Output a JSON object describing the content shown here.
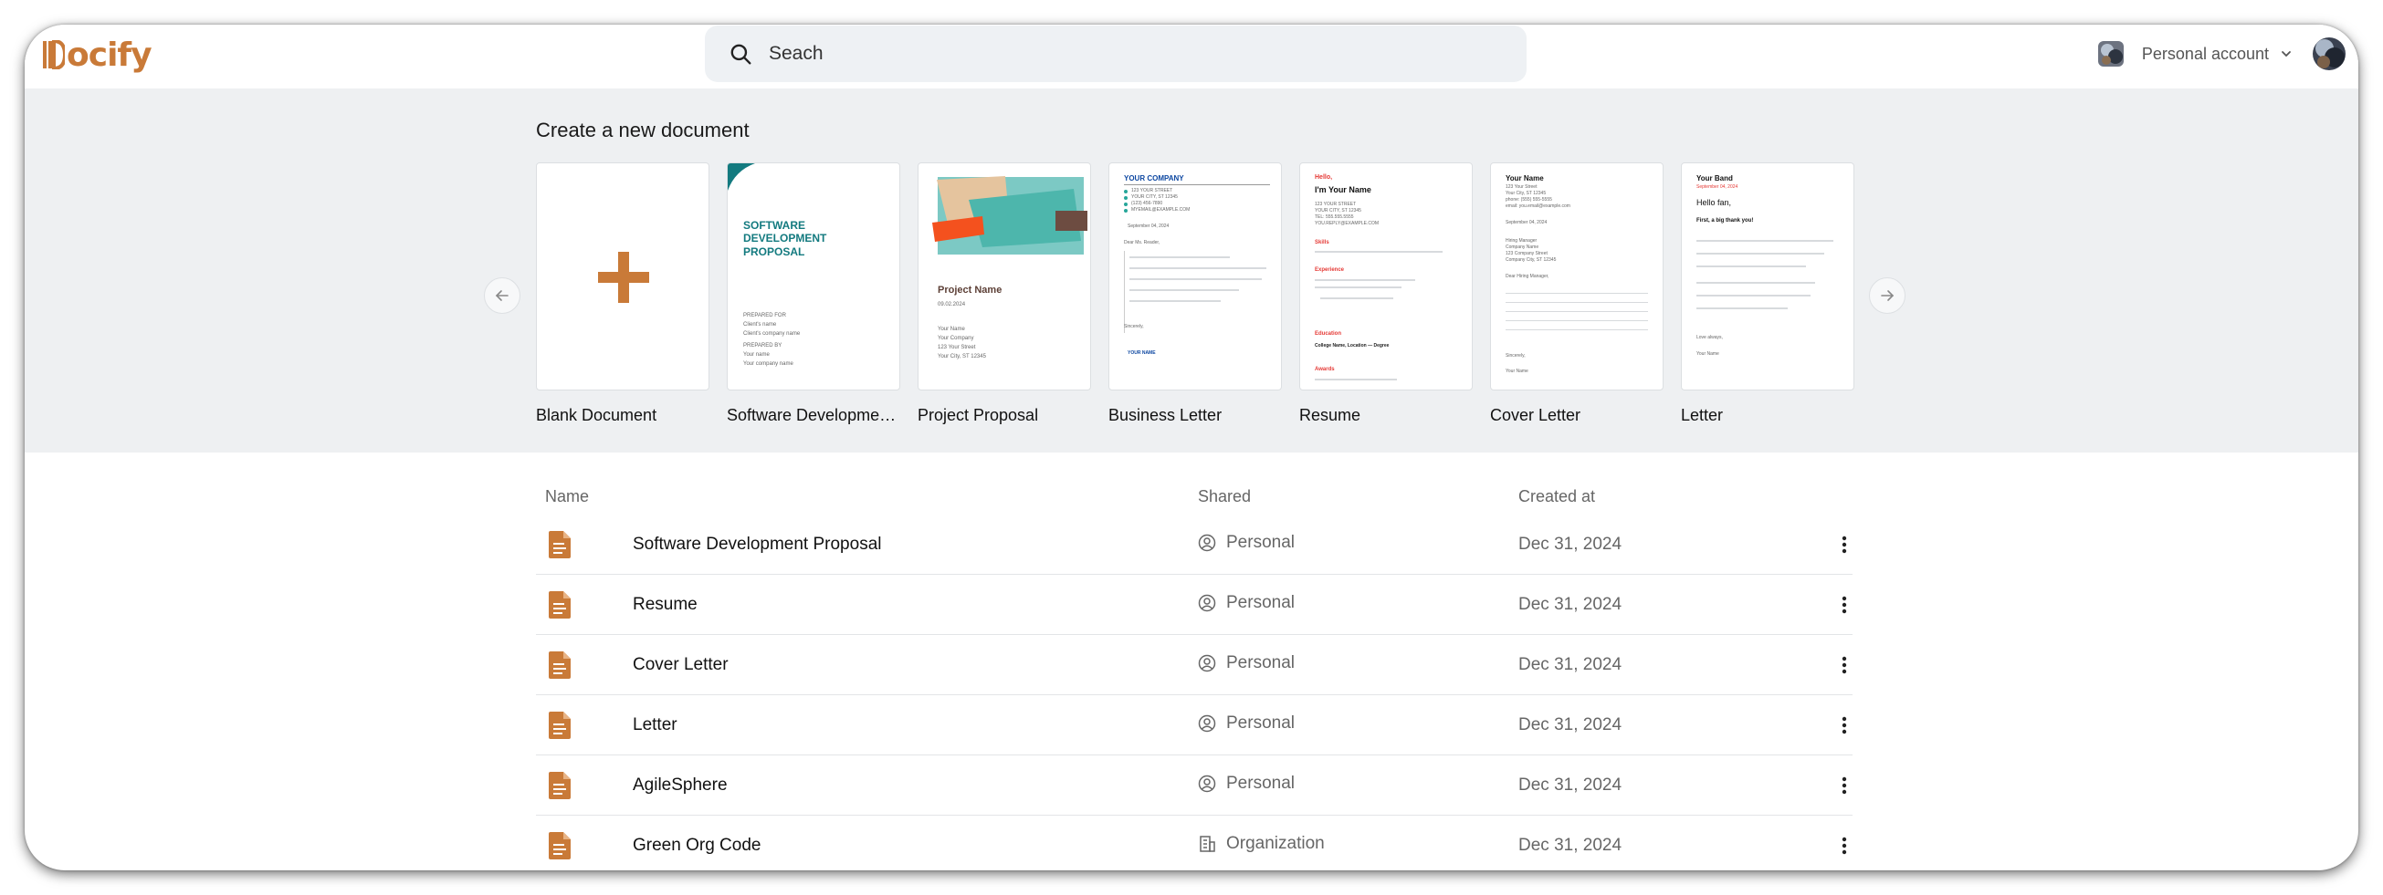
{
  "brand": {
    "name": "ocify",
    "color": "#c97a38"
  },
  "search": {
    "placeholder": "Seach",
    "icon": "search-icon"
  },
  "account": {
    "label": "Personal account",
    "icon": "chevron-down-icon"
  },
  "templates_section": {
    "title": "Create a new document",
    "templates": [
      {
        "label": "Blank Document"
      },
      {
        "label": "Software Development Proposal",
        "preview_title": "SOFTWARE DEVELOPMENT PROPOSAL",
        "preview_lines": [
          "PREPARED FOR",
          "Client's name",
          "Client's company name",
          "PREPARED BY",
          "Your name",
          "Your company name"
        ]
      },
      {
        "label": "Project Proposal",
        "preview_title": "Project Name",
        "preview_date": "09.02.2024",
        "preview_lines": [
          "Your Name",
          "Your Company",
          "123 Your Street",
          "Your City, ST 12345"
        ]
      },
      {
        "label": "Business Letter",
        "preview_title": "YOUR COMPANY",
        "preview_lines": [
          "123 YOUR STREET",
          "YOUR CITY, ST 12345",
          "(123) 456-7890",
          "MYEMAIL@EXAMPLE.COM",
          "September 04, 2024",
          "Dear Ms. Reader,",
          "Sincerely,",
          "YOUR NAME"
        ]
      },
      {
        "label": "Resume",
        "preview_lines": [
          "Hello,",
          "I'm Your Name",
          "123 YOUR STREET",
          "YOUR CITY, ST 12345",
          "TEL: 555.555.5555",
          "YOU.REPLY@EXAMPLE.COM",
          "Skills",
          "Experience",
          "Education",
          "College Name, Location — Degree",
          "Awards"
        ]
      },
      {
        "label": "Cover Letter",
        "preview_lines": [
          "Your Name",
          "123 Your Street",
          "Your City, ST 12345",
          "phone: (555) 555-5555",
          "email: you.email@example.com",
          "September 04, 2024",
          "Hiring Manager",
          "Company Name",
          "123 Company Street",
          "Company City, ST 12345",
          "Dear Hiring Manager,",
          "Sincerely,",
          "Your Name"
        ]
      },
      {
        "label": "Letter",
        "preview_lines": [
          "Your Band",
          "September 04, 2024",
          "Hello fan,",
          "First, a big thank you!",
          "Love always,",
          "Your Name"
        ]
      }
    ]
  },
  "documents": {
    "columns": {
      "name": "Name",
      "shared": "Shared",
      "created": "Created at"
    },
    "rows": [
      {
        "name": "Software Development Proposal",
        "shared": "Personal",
        "shared_icon": "user-circle-icon",
        "created": "Dec 31, 2024"
      },
      {
        "name": "Resume",
        "shared": "Personal",
        "shared_icon": "user-circle-icon",
        "created": "Dec 31, 2024"
      },
      {
        "name": "Cover Letter",
        "shared": "Personal",
        "shared_icon": "user-circle-icon",
        "created": "Dec 31, 2024"
      },
      {
        "name": "Letter",
        "shared": "Personal",
        "shared_icon": "user-circle-icon",
        "created": "Dec 31, 2024"
      },
      {
        "name": "AgileSphere",
        "shared": "Personal",
        "shared_icon": "user-circle-icon",
        "created": "Dec 31, 2024"
      },
      {
        "name": "Green Org Code",
        "shared": "Organization",
        "shared_icon": "building-icon",
        "created": "Dec 31, 2024"
      }
    ]
  },
  "colors": {
    "accent": "#c97a38",
    "template_teal": "#137a7f",
    "resume_red": "#e53935",
    "panel_bg": "#eef0f2"
  }
}
